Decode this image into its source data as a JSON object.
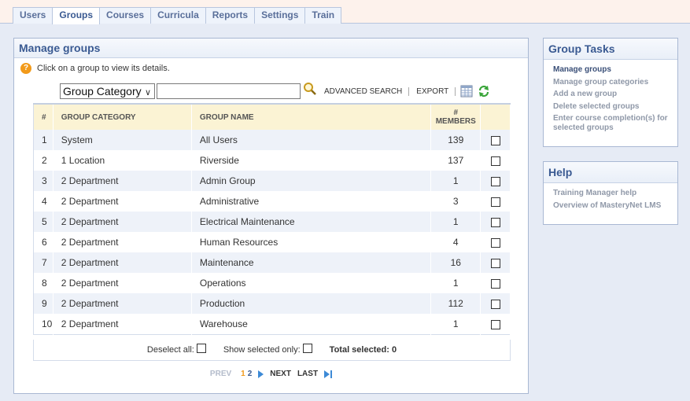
{
  "tabs": [
    {
      "label": "Users",
      "active": false
    },
    {
      "label": "Groups",
      "active": true
    },
    {
      "label": "Courses",
      "active": false
    },
    {
      "label": "Curricula",
      "active": false
    },
    {
      "label": "Reports",
      "active": false
    },
    {
      "label": "Settings",
      "active": false
    },
    {
      "label": "Train",
      "active": false
    }
  ],
  "main": {
    "title": "Manage groups",
    "hint": "Click on a group to view its details.",
    "search": {
      "category_select": "Group Category",
      "input_value": "",
      "advanced_search": "ADVANCED SEARCH",
      "export": "EXPORT"
    },
    "table": {
      "headers": {
        "num": "#",
        "category": "GROUP CATEGORY",
        "name": "GROUP NAME",
        "members_line1": "#",
        "members_line2": "MEMBERS"
      },
      "rows": [
        {
          "num": "1",
          "category": "System",
          "name": "All Users",
          "members": "139"
        },
        {
          "num": "2",
          "category": "1 Location",
          "name": "Riverside",
          "members": "137"
        },
        {
          "num": "3",
          "category": "2 Department",
          "name": "Admin Group",
          "members": "1"
        },
        {
          "num": "4",
          "category": "2 Department",
          "name": "Administrative",
          "members": "3"
        },
        {
          "num": "5",
          "category": "2 Department",
          "name": "Electrical Maintenance",
          "members": "1"
        },
        {
          "num": "6",
          "category": "2 Department",
          "name": "Human Resources",
          "members": "4"
        },
        {
          "num": "7",
          "category": "2 Department",
          "name": "Maintenance",
          "members": "16"
        },
        {
          "num": "8",
          "category": "2 Department",
          "name": "Operations",
          "members": "1"
        },
        {
          "num": "9",
          "category": "2 Department",
          "name": "Production",
          "members": "112"
        },
        {
          "num": "10",
          "category": "2 Department",
          "name": "Warehouse",
          "members": "1"
        }
      ]
    },
    "footer": {
      "deselect_all": "Deselect all:",
      "show_selected_only": "Show selected only:",
      "total_selected_label": "Total selected:",
      "total_selected_value": "0"
    },
    "pager": {
      "prev": "PREV",
      "page1": "1",
      "page2": "2",
      "next": "NEXT",
      "last": "LAST"
    }
  },
  "group_tasks": {
    "title": "Group Tasks",
    "items": [
      "Manage groups",
      "Manage group categories",
      "Add a new group",
      "Delete selected groups",
      "Enter course completion(s) for selected groups"
    ]
  },
  "help": {
    "title": "Help",
    "items": [
      "Training Manager help",
      "Overview of MasteryNet LMS"
    ]
  },
  "colors": {
    "accent": "#3a5a92",
    "header_bg": "#fbf3d4",
    "row_alt": "#eef2f9",
    "hint_icon": "#f29a1a"
  }
}
